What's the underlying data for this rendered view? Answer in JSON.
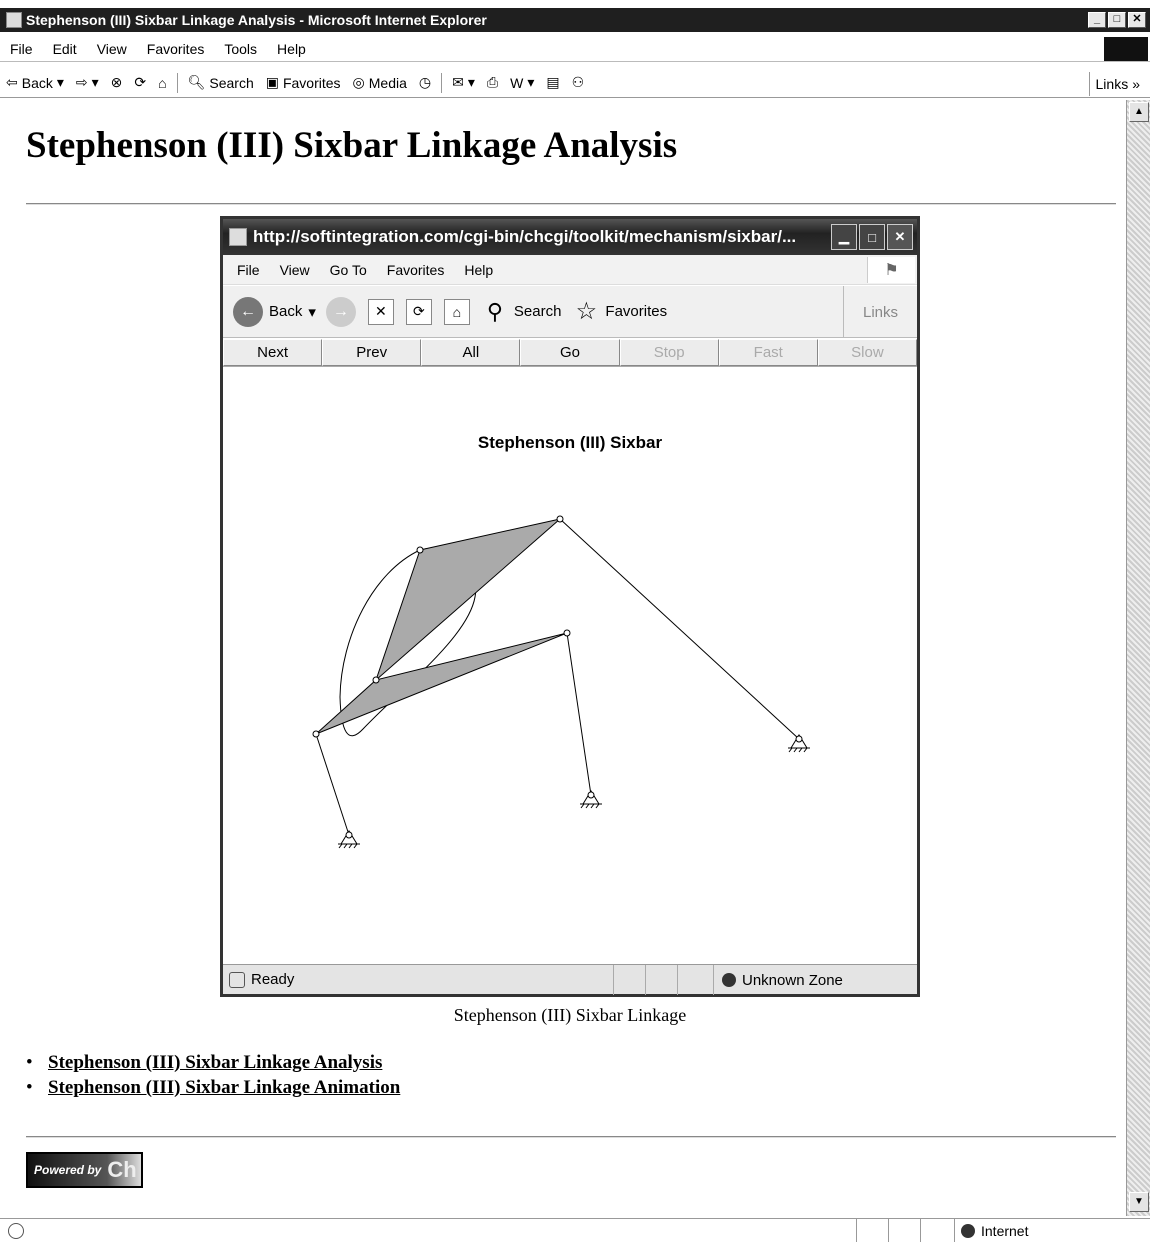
{
  "browser": {
    "title": "Stephenson (III) Sixbar Linkage Analysis - Microsoft Internet Explorer",
    "menu": [
      "File",
      "Edit",
      "View",
      "Favorites",
      "Tools",
      "Help"
    ],
    "toolbar": {
      "back": "Back",
      "search": "Search",
      "favorites": "Favorites",
      "media": "Media",
      "links": "Links"
    },
    "status": {
      "zone": "Internet"
    }
  },
  "page": {
    "heading": "Stephenson (III) Sixbar Linkage Analysis",
    "caption": "Stephenson (III) Sixbar Linkage",
    "links": [
      "Stephenson (III) Sixbar Linkage Analysis",
      "Stephenson (III) Sixbar Linkage Animation"
    ],
    "powered_by": {
      "prefix": "Powered by",
      "brand": "Ch"
    }
  },
  "embedded_window": {
    "title": "http://softintegration.com/cgi-bin/chcgi/toolkit/mechanism/sixbar/...",
    "menu": [
      "File",
      "View",
      "Go To",
      "Favorites",
      "Help"
    ],
    "toolbar": {
      "back": "Back",
      "search": "Search",
      "favorites": "Favorites",
      "links": "Links"
    },
    "nav_buttons": [
      {
        "label": "Next",
        "enabled": true
      },
      {
        "label": "Prev",
        "enabled": true
      },
      {
        "label": "All",
        "enabled": true
      },
      {
        "label": "Go",
        "enabled": true
      },
      {
        "label": "Stop",
        "enabled": false
      },
      {
        "label": "Fast",
        "enabled": false
      },
      {
        "label": "Slow",
        "enabled": false
      }
    ],
    "plot_title": "Stephenson (III) Sixbar",
    "status": {
      "text": "Ready",
      "zone": "Unknown Zone"
    }
  }
}
